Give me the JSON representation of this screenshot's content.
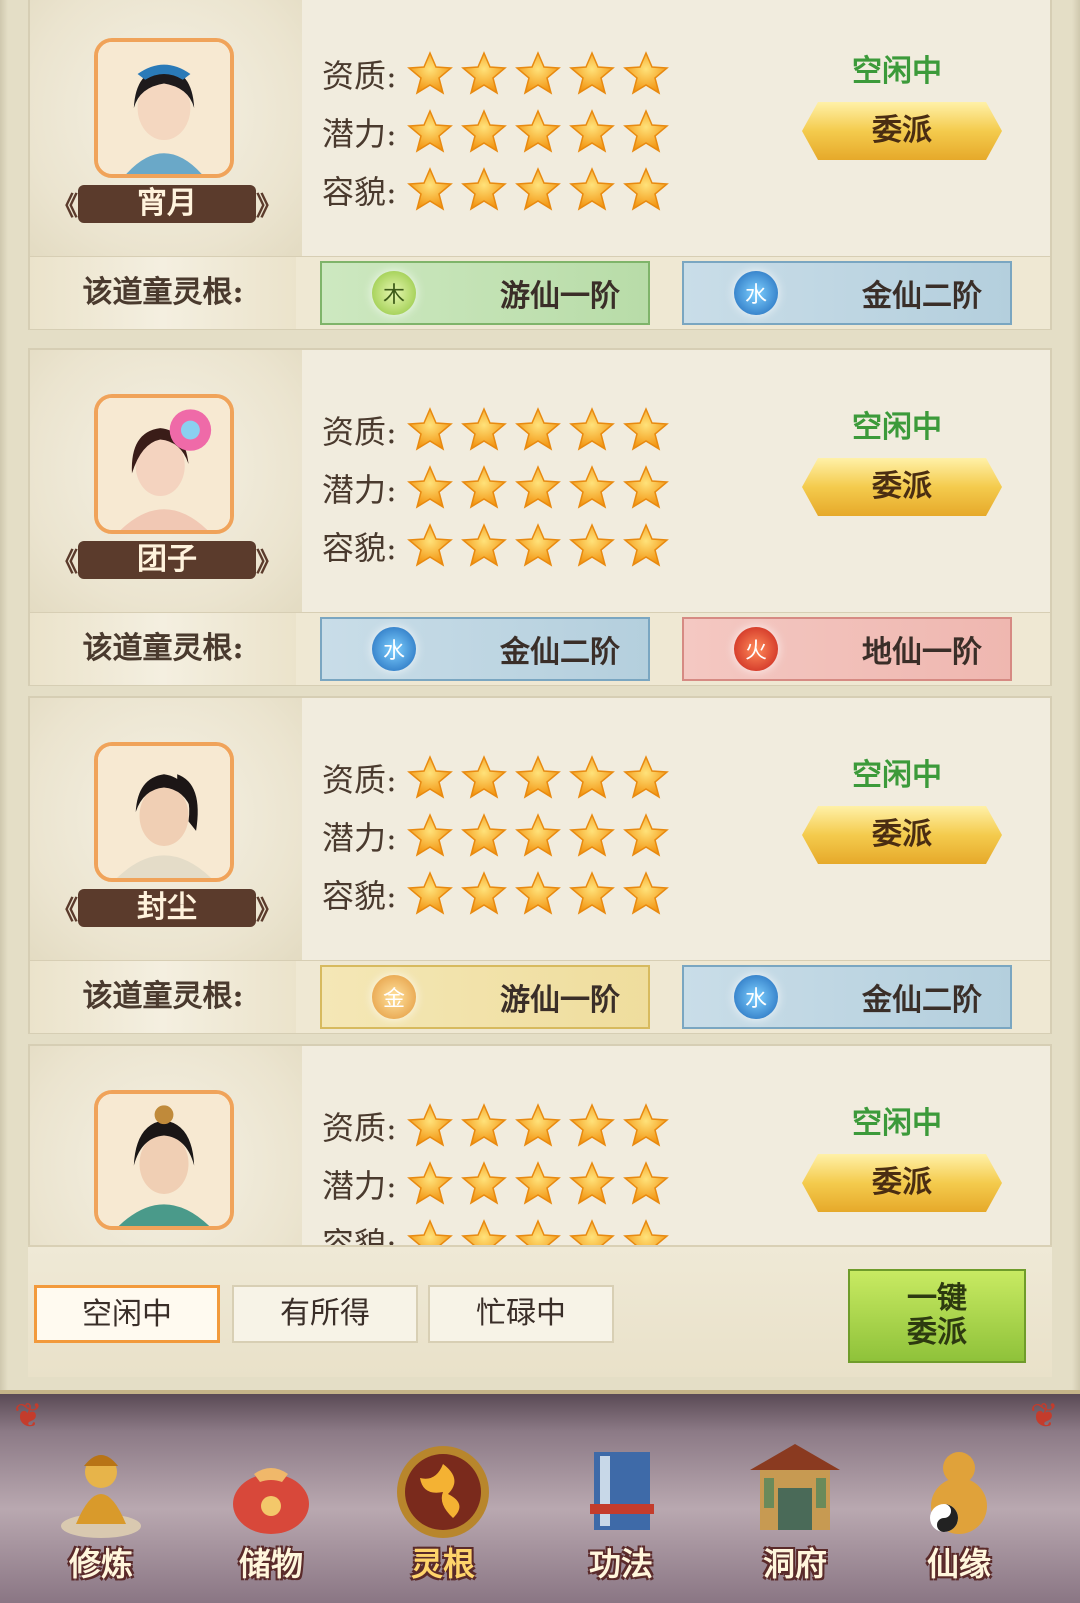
{
  "labels": {
    "aptitude": "资质:",
    "potential": "潜力:",
    "looks": "容貌:",
    "spirit_root": "该道童灵根:"
  },
  "cards": [
    {
      "name": "宵月",
      "status": "空闲中",
      "assign": "委派",
      "stars": {
        "aptitude": 5,
        "potential": 5,
        "looks": 5
      },
      "roots": [
        {
          "element": "木",
          "rank": "游仙一阶",
          "type": "wood"
        },
        {
          "element": "水",
          "rank": "金仙二阶",
          "type": "water"
        }
      ]
    },
    {
      "name": "团子",
      "status": "空闲中",
      "assign": "委派",
      "stars": {
        "aptitude": 5,
        "potential": 5,
        "looks": 5
      },
      "roots": [
        {
          "element": "水",
          "rank": "金仙二阶",
          "type": "water"
        },
        {
          "element": "火",
          "rank": "地仙一阶",
          "type": "fire"
        }
      ]
    },
    {
      "name": "封尘",
      "status": "空闲中",
      "assign": "委派",
      "stars": {
        "aptitude": 5,
        "potential": 5,
        "looks": 5
      },
      "roots": [
        {
          "element": "金",
          "rank": "游仙一阶",
          "type": "metal"
        },
        {
          "element": "水",
          "rank": "金仙二阶",
          "type": "water"
        }
      ]
    },
    {
      "name": "",
      "status": "空闲中",
      "assign": "委派",
      "stars": {
        "aptitude": 5,
        "potential": 5,
        "looks": 5
      },
      "roots": []
    }
  ],
  "tabs": [
    {
      "label": "空闲中",
      "active": true
    },
    {
      "label": "有所得",
      "active": false
    },
    {
      "label": "忙碌中",
      "active": false
    }
  ],
  "one_key": {
    "line1": "一键",
    "line2": "委派"
  },
  "nav": [
    {
      "label": "修炼",
      "icon": "meditating-monk-icon"
    },
    {
      "label": "储物",
      "icon": "storage-bag-icon"
    },
    {
      "label": "灵根",
      "icon": "spirit-root-emblem-icon",
      "active": true
    },
    {
      "label": "功法",
      "icon": "skill-book-icon"
    },
    {
      "label": "洞府",
      "icon": "cave-mansion-icon"
    },
    {
      "label": "仙缘",
      "icon": "gourd-yinyang-icon"
    }
  ],
  "colors": {
    "status_green": "#3c9a3a",
    "star": "#f6a51a",
    "active_tab": "#f29a3c"
  }
}
